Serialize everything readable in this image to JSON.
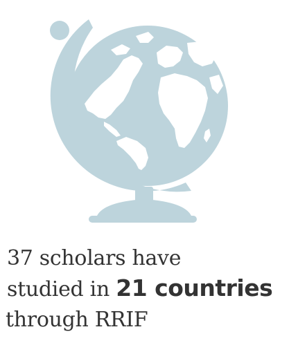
{
  "illustration": {
    "icon": "globe-icon",
    "color": "#BDD4DC"
  },
  "stat": {
    "line1": "37 scholars have",
    "line2_prefix": "studied in",
    "line2_emphasis": "21 countries",
    "line3": "through RRIF"
  }
}
